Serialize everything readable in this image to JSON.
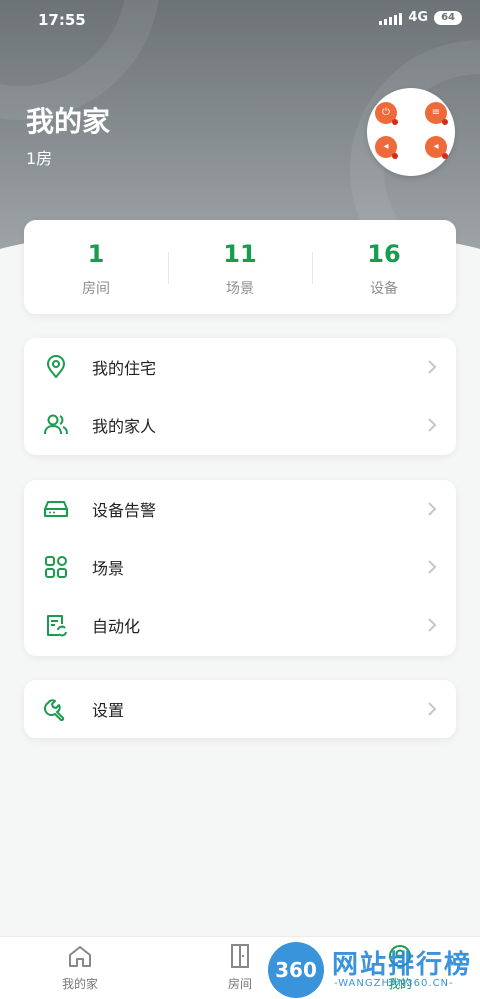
{
  "status_bar": {
    "time": "17:55",
    "network": "4G",
    "battery": "64"
  },
  "home": {
    "name": "我的家",
    "rooms_summary": "1房"
  },
  "stats": [
    {
      "value": "1",
      "label": "房间"
    },
    {
      "value": "11",
      "label": "场景"
    },
    {
      "value": "16",
      "label": "设备"
    }
  ],
  "menu_group1": [
    {
      "label": "我的住宅",
      "icon": "location-pin-icon"
    },
    {
      "label": "我的家人",
      "icon": "people-icon"
    }
  ],
  "menu_group2": [
    {
      "label": "设备告警",
      "icon": "device-alarm-icon"
    },
    {
      "label": "场景",
      "icon": "scene-grid-icon"
    },
    {
      "label": "自动化",
      "icon": "automation-icon"
    }
  ],
  "menu_group3": [
    {
      "label": "设置",
      "icon": "wrench-icon"
    }
  ],
  "bottom_nav": [
    {
      "label": "我的家",
      "icon": "home-icon"
    },
    {
      "label": "房间",
      "icon": "door-icon"
    },
    {
      "label": "我的",
      "icon": "profile-icon"
    }
  ],
  "watermark": {
    "badge": "360",
    "title": "网站排行榜",
    "url": "-WANGZHAN360.CN-"
  },
  "colors": {
    "accent": "#1a9c4f",
    "header": "#7d8488",
    "device_button": "#ef6a3a"
  }
}
